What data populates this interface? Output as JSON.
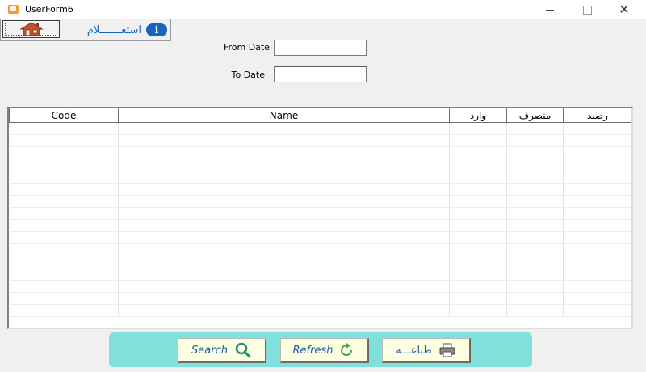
{
  "window": {
    "title": "UserForm6"
  },
  "tabs": {
    "inquiry_label": "استعـــــــلام",
    "info_glyph": "i"
  },
  "filters": {
    "from_label": "From Date",
    "to_label": "To Date",
    "from_value": "",
    "to_value": ""
  },
  "grid": {
    "columns": [
      "Code",
      "Name",
      "وارد",
      "منصرف",
      "رصيد"
    ],
    "rows": []
  },
  "actions": {
    "search_label": "Search",
    "refresh_label": "Refresh",
    "print_label": "طباعـــه"
  },
  "colors": {
    "panel": "#80e0dc",
    "button_bg": "#ffffe1",
    "accent": "#1565c0"
  }
}
